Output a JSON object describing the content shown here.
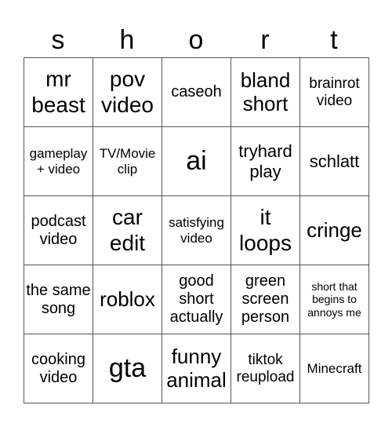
{
  "title_letters": [
    "s",
    "h",
    "o",
    "r",
    "t"
  ],
  "rows": [
    [
      "mr beast",
      "pov video",
      "caseoh",
      "bland short",
      "brainrot video"
    ],
    [
      "gameplay + video",
      "TV/Movie clip",
      "ai",
      "tryhard play",
      "schlatt"
    ],
    [
      "podcast video",
      "car edit",
      "satisfying video",
      "it loops",
      "cringe"
    ],
    [
      "the same song",
      "roblox",
      "good short actually",
      "green screen person",
      "short that begins to annoys me"
    ],
    [
      "cooking video",
      "gta",
      "funny animal",
      "tiktok reupload",
      "Minecraft"
    ]
  ]
}
